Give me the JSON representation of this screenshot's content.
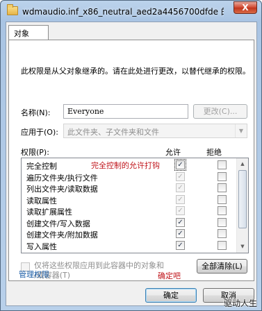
{
  "window": {
    "title": "wdmaudio.inf_x86_neutral_aed2a4456700dfde 的权...",
    "close_glyph": "X"
  },
  "tab": {
    "label": "对象"
  },
  "description": "此权限是从父对象继承的。请在此处进行更改，以替代继承的权限。",
  "name_row": {
    "label": "名称(N):",
    "value": "Everyone",
    "change_button": "更改(C)..."
  },
  "apply_row": {
    "label": "应用于(O):",
    "value": "此文件夹、子文件夹和文件"
  },
  "permissions": {
    "header": "权限(P):",
    "allow_header": "允许",
    "deny_header": "拒绝",
    "annotation": "完全控制的允许打钩",
    "rows": [
      {
        "name": "完全控制",
        "allow": true,
        "allow_enabled": true,
        "deny": false
      },
      {
        "name": "遍历文件夹/执行文件",
        "allow": true,
        "allow_enabled": false,
        "deny": false
      },
      {
        "name": "列出文件夹/读取数据",
        "allow": true,
        "allow_enabled": false,
        "deny": false
      },
      {
        "name": "读取属性",
        "allow": true,
        "allow_enabled": false,
        "deny": false
      },
      {
        "name": "读取扩展属性",
        "allow": true,
        "allow_enabled": false,
        "deny": false
      },
      {
        "name": "创建文件/写入数据",
        "allow": true,
        "allow_enabled": true,
        "deny": false
      },
      {
        "name": "创建文件夹/附加数据",
        "allow": true,
        "allow_enabled": true,
        "deny": false
      },
      {
        "name": "写入属性",
        "allow": true,
        "allow_enabled": true,
        "deny": false
      }
    ]
  },
  "inherit_checkbox": {
    "label_line1": "仅将这些权限应用到此容器中的对象和",
    "label_line2": "/或容器(T)"
  },
  "clear_all_button": "全部清除(L)",
  "manage_link": "管理权限",
  "confirm_note": "确定吧",
  "ok_button": "确定",
  "cancel_button": "取消",
  "watermark": "驱动人生",
  "colors": {
    "annotation": "#c0151b",
    "link": "#1a5ca6"
  }
}
